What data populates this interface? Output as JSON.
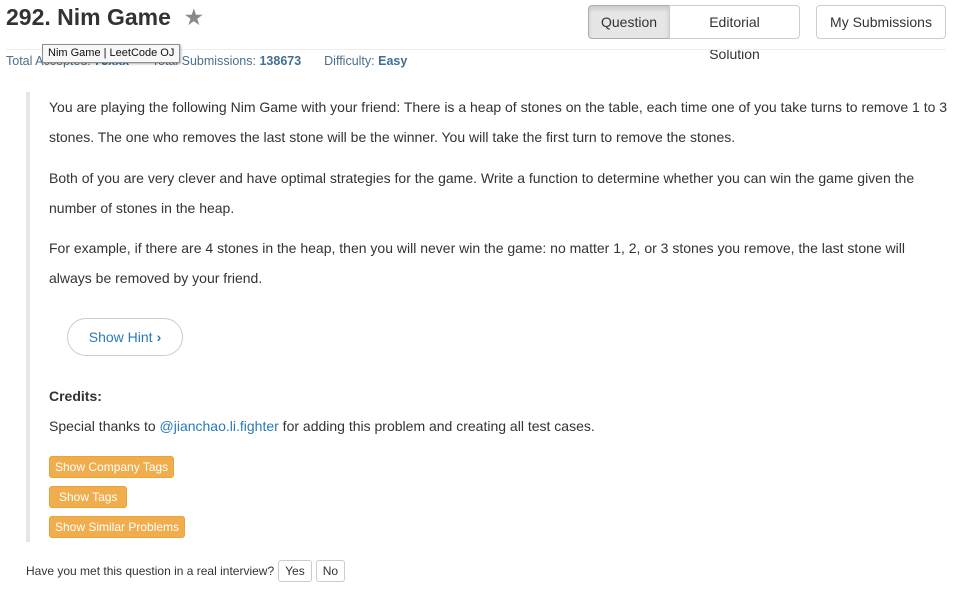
{
  "header": {
    "title": "292. Nim Game",
    "star_icon": "star-icon",
    "tabs": [
      "Question",
      "Editorial Solution"
    ],
    "submissions_label": "My Submissions",
    "tooltip": "Nim Game | LeetCode OJ"
  },
  "stats": {
    "accepted_label": "Total Accepted:",
    "accepted_value": "73xxx",
    "submissions_label": "Total Submissions:",
    "submissions_value": "138673",
    "difficulty_label": "Difficulty:",
    "difficulty_value": "Easy"
  },
  "content": {
    "paragraphs": [
      "You are playing the following Nim Game with your friend: There is a heap of stones on the table, each time one of you take turns to remove 1 to 3 stones. The one who removes the last stone will be the winner. You will take the first turn to remove the stones.",
      "Both of you are very clever and have optimal strategies for the game. Write a function to determine whether you can win the game given the number of stones in the heap.",
      "For example, if there are 4 stones in the heap, then you will never win the game: no matter 1, 2, or 3 stones you remove, the last stone will always be removed by your friend."
    ],
    "hint_label": "Show Hint",
    "credits_heading": "Credits:",
    "credits_prefix": "Special thanks to ",
    "credits_link": "@jianchao.li.fighter",
    "credits_suffix": " for adding this problem and creating all test cases.",
    "tag_buttons": [
      "Show Company Tags",
      "Show Tags",
      "Show Similar Problems"
    ]
  },
  "interview": {
    "question": "Have you met this question in a real interview?",
    "yes": "Yes",
    "no": "No"
  },
  "colors": {
    "link": "#2a7ab8",
    "tag_button": "#f0ad4e",
    "stats_bold": "#3f6f93"
  }
}
